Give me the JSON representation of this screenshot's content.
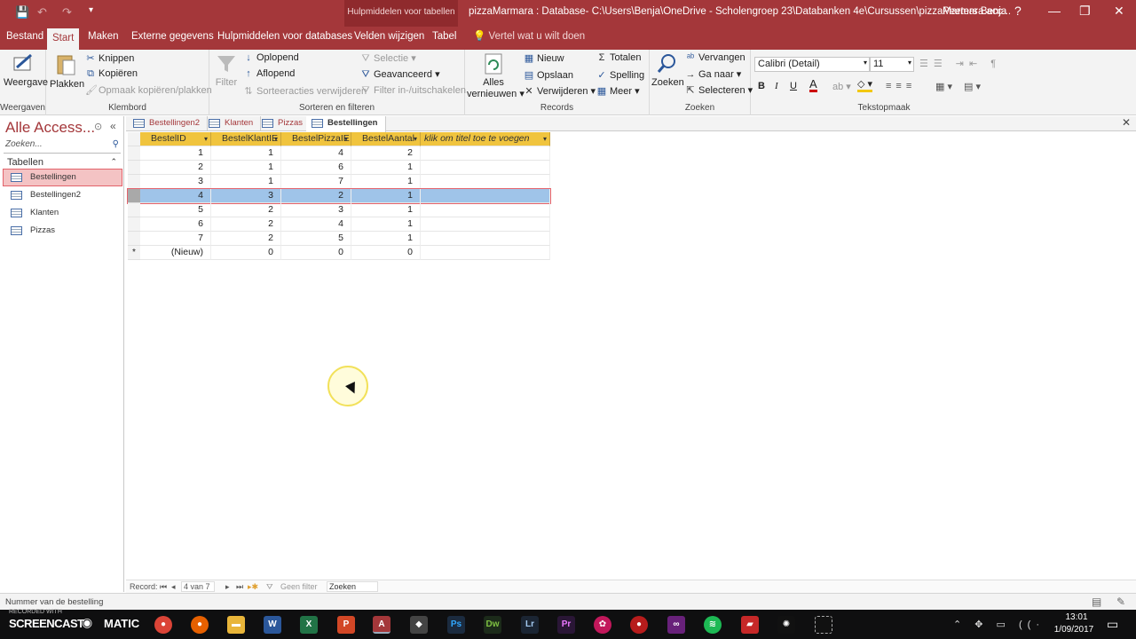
{
  "titlebar": {
    "context_label": "Hulpmiddelen voor tabellen",
    "title": "pizzaMarmara : Database- C:\\Users\\Benja\\OneDrive - Scholengroep 23\\Databanken 4e\\Cursussen\\pizzaMarmara.acc...",
    "user": "Peeters Benja",
    "help": "?",
    "minimize": "—",
    "restore": "❐",
    "close": "✕",
    "save_icon": "💾",
    "undo_icon": "↶",
    "redo_icon": "↷"
  },
  "ribbon_tabs": [
    "Bestand",
    "Start",
    "Maken",
    "Externe gegevens",
    "Hulpmiddelen voor databases",
    "Velden wijzigen",
    "Tabel"
  ],
  "tell_me": "Vertel wat u wilt doen",
  "ribbon": {
    "weergaven": {
      "label": "Weergaven",
      "weergave": "Weergave"
    },
    "klembord": {
      "label": "Klembord",
      "plakken": "Plakken",
      "knippen": "Knippen",
      "kopieren": "Kopiëren",
      "opmaak": "Opmaak kopiëren/plakken"
    },
    "sorteren": {
      "label": "Sorteren en filteren",
      "filter": "Filter",
      "oplopend": "Oplopend",
      "aflopend": "Aflopend",
      "verwijderen": "Sorteeracties verwijderen",
      "selectie": "Selectie",
      "geavanceerd": "Geavanceerd",
      "inuit": "Filter in-/uitschakelen"
    },
    "records": {
      "label": "Records",
      "alles": "Alles",
      "vernieuwen": "vernieuwen",
      "nieuw": "Nieuw",
      "opslaan": "Opslaan",
      "verwijderen": "Verwijderen",
      "totalen": "Totalen",
      "spelling": "Spelling",
      "meer": "Meer"
    },
    "zoeken": {
      "label": "Zoeken",
      "zoeken": "Zoeken",
      "vervangen": "Vervangen",
      "ganaar": "Ga naar",
      "selecteren": "Selecteren"
    },
    "tekstopmaak": {
      "label": "Tekstopmaak",
      "font": "Calibri (Detail)",
      "size": "11",
      "bold": "B",
      "italic": "I",
      "underline": "U",
      "font_color": "A"
    }
  },
  "nav": {
    "title": "Alle Access...",
    "search_placeholder": "Zoeken...",
    "category": "Tabellen",
    "items": [
      "Bestellingen",
      "Bestellingen2",
      "Klanten",
      "Pizzas"
    ],
    "selected_index": 0
  },
  "doctabs": [
    "Bestellingen2",
    "Klanten",
    "Pizzas",
    "Bestellingen"
  ],
  "active_doctab": 3,
  "table": {
    "columns": [
      "BestelID",
      "BestelKlantIE",
      "BestelPizzaIE",
      "BestelAantal",
      "klik om titel toe te voegen"
    ],
    "rows": [
      [
        "1",
        "1",
        "4",
        "2"
      ],
      [
        "2",
        "1",
        "6",
        "1"
      ],
      [
        "3",
        "1",
        "7",
        "1"
      ],
      [
        "4",
        "3",
        "2",
        "1"
      ],
      [
        "5",
        "2",
        "3",
        "1"
      ],
      [
        "6",
        "2",
        "4",
        "1"
      ],
      [
        "7",
        "2",
        "5",
        "1"
      ]
    ],
    "new_row": [
      "(Nieuw)",
      "0",
      "0",
      "0"
    ],
    "new_row_marker": "*",
    "selected_row": 3
  },
  "recnav": {
    "label": "Record:",
    "position": "4 van 7",
    "filter": "Geen filter",
    "search": "Zoeken"
  },
  "status": {
    "text": "Nummer van de bestelling"
  },
  "taskbar": {
    "recorded": "RECORDED WITH",
    "brand": "SCREENCAST",
    "matic": "MATIC",
    "time": "13:01",
    "date": "1/09/2017"
  },
  "colors": {
    "accent": "#a4373a",
    "header": "#f0c43e",
    "selected_row": "#9fc4e9"
  }
}
